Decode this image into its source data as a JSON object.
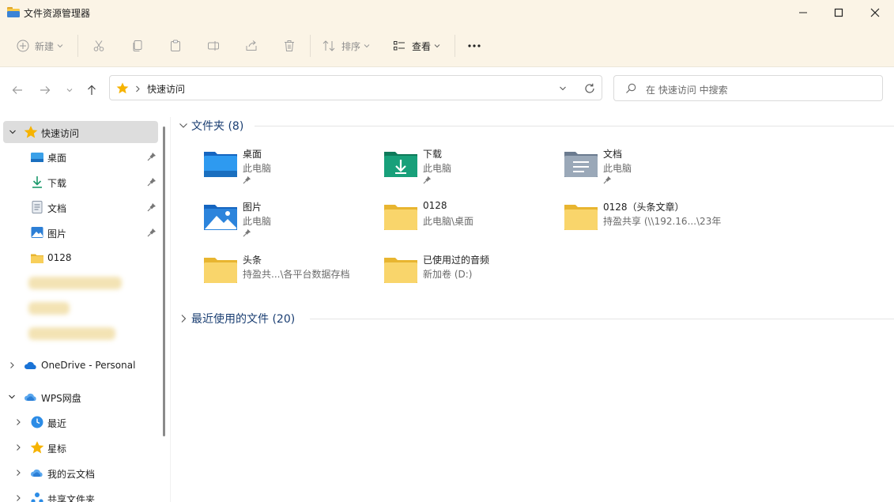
{
  "window": {
    "title": "文件资源管理器"
  },
  "toolbar": {
    "new_label": "新建",
    "sort_label": "排序",
    "view_label": "查看"
  },
  "address": {
    "crumb": "快速访问"
  },
  "search": {
    "placeholder": "在 快速访问 中搜索"
  },
  "sidebar": {
    "quick_access": "快速访问",
    "items": [
      {
        "label": "桌面",
        "icon": "desktop-icon",
        "pinned": true
      },
      {
        "label": "下载",
        "icon": "download-icon",
        "pinned": true
      },
      {
        "label": "文档",
        "icon": "document-icon",
        "pinned": true
      },
      {
        "label": "图片",
        "icon": "pictures-icon",
        "pinned": true
      },
      {
        "label": "0128",
        "icon": "folder-icon",
        "pinned": false
      }
    ],
    "onedrive": "OneDrive - Personal",
    "wps": "WPS网盘",
    "wps_items": [
      {
        "label": "最近",
        "icon": "clock-icon"
      },
      {
        "label": "星标",
        "icon": "star-icon"
      },
      {
        "label": "我的云文档",
        "icon": "cloud-icon"
      },
      {
        "label": "共享文件夹",
        "icon": "share-icon"
      }
    ]
  },
  "main": {
    "folders_header": "文件夹 (8)",
    "recent_header": "最近使用的文件 (20)",
    "folders": [
      {
        "name": "桌面",
        "sub": "此电脑",
        "pinned": true,
        "icon": "desktop-folder-icon"
      },
      {
        "name": "下载",
        "sub": "此电脑",
        "pinned": true,
        "icon": "download-folder-icon"
      },
      {
        "name": "文档",
        "sub": "此电脑",
        "pinned": true,
        "icon": "document-folder-icon"
      },
      {
        "name": "图片",
        "sub": "此电脑",
        "pinned": true,
        "icon": "pictures-folder-icon"
      },
      {
        "name": "0128",
        "sub": "此电脑\\桌面",
        "pinned": false,
        "icon": "folder-icon"
      },
      {
        "name": "0128（头条文章）",
        "sub": "持盈共享 (\\\\192.16...\\23年",
        "pinned": false,
        "icon": "folder-icon"
      },
      {
        "name": "头条",
        "sub": "持盈共...\\各平台数据存档",
        "pinned": false,
        "icon": "folder-icon"
      },
      {
        "name": "已使用过的音频",
        "sub": "新加卷 (D:)",
        "pinned": false,
        "icon": "folder-icon"
      }
    ]
  },
  "colors": {
    "chrome_bg": "#fbf4e6",
    "section_header": "#1a3e72",
    "folder_yellow": "#f7c948",
    "selected_bg": "#dddddd"
  }
}
